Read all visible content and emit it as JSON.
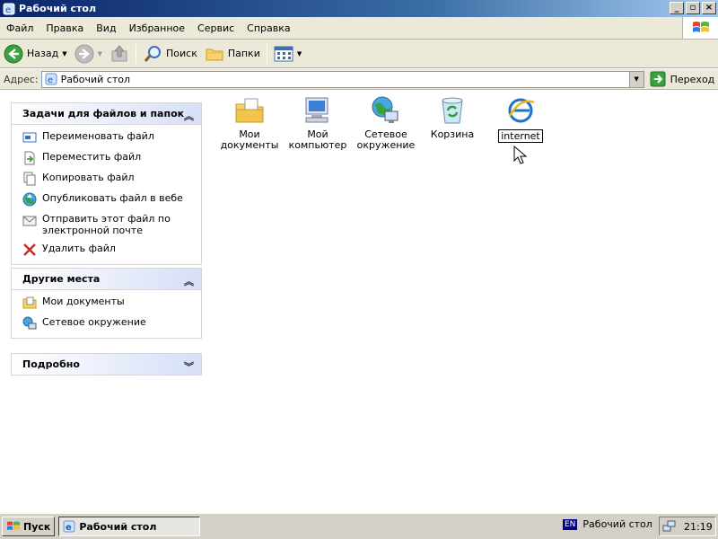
{
  "window": {
    "title": "Рабочий стол"
  },
  "menu": [
    "Файл",
    "Правка",
    "Вид",
    "Избранное",
    "Сервис",
    "Справка"
  ],
  "toolbar": {
    "back": "Назад",
    "search": "Поиск",
    "folders": "Папки"
  },
  "address": {
    "label": "Адрес:",
    "value": "Рабочий стол",
    "go": "Переход"
  },
  "tasks": {
    "title": "Задачи для файлов и папок",
    "items": [
      {
        "label": "Переименовать файл",
        "icon": "rename-icon"
      },
      {
        "label": "Переместить файл",
        "icon": "move-icon"
      },
      {
        "label": "Копировать файл",
        "icon": "copy-icon"
      },
      {
        "label": "Опубликовать файл в вебе",
        "icon": "publish-web-icon"
      },
      {
        "label": "Отправить этот файл по электронной почте",
        "icon": "email-icon"
      },
      {
        "label": "Удалить файл",
        "icon": "delete-icon"
      }
    ]
  },
  "places": {
    "title": "Другие места",
    "items": [
      {
        "label": "Мои документы",
        "icon": "my-documents-icon"
      },
      {
        "label": "Сетевое окружение",
        "icon": "network-places-icon"
      }
    ]
  },
  "details": {
    "title": "Подробно"
  },
  "desktop_icons": [
    {
      "label": "Мои документы",
      "icon": "my-documents-folder-icon"
    },
    {
      "label": "Мой компьютер",
      "icon": "my-computer-icon"
    },
    {
      "label": "Сетевое окружение",
      "icon": "network-neighborhood-icon"
    },
    {
      "label": "Корзина",
      "icon": "recycle-bin-icon"
    },
    {
      "label": "internet",
      "icon": "internet-explorer-icon"
    }
  ],
  "taskbar": {
    "start": "Пуск",
    "task": "Рабочий стол",
    "lang": "EN",
    "desktop_label": "Рабочий стол",
    "clock": "21:19"
  }
}
